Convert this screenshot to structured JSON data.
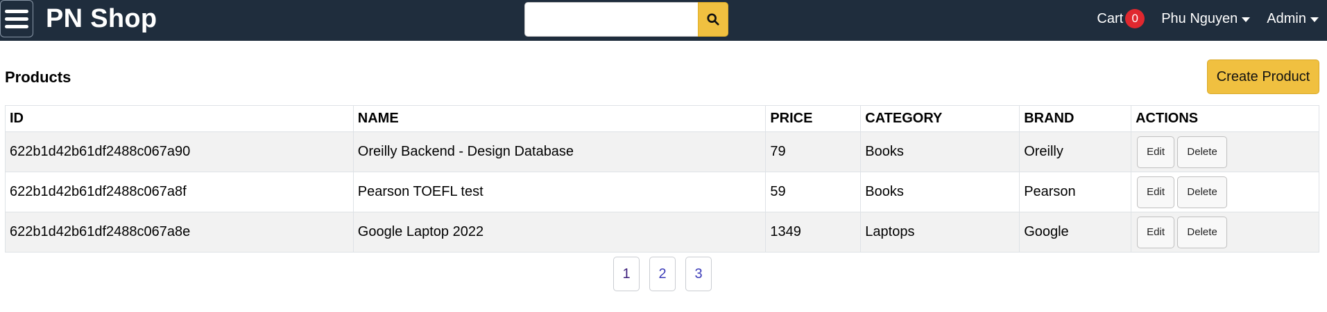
{
  "navbar": {
    "brand": "PN Shop",
    "search": {
      "value": "",
      "placeholder": ""
    },
    "cart_label": "Cart",
    "cart_count": "0",
    "user_name": "Phu Nguyen",
    "admin_label": "Admin"
  },
  "page": {
    "title": "Products",
    "create_label": "Create Product"
  },
  "table": {
    "headers": [
      "ID",
      "NAME",
      "PRICE",
      "CATEGORY",
      "BRAND",
      "ACTIONS"
    ],
    "rows": [
      {
        "id": "622b1d42b61df2488c067a90",
        "name": "Oreilly Backend - Design Database",
        "price": "79",
        "category": "Books",
        "brand": "Oreilly"
      },
      {
        "id": "622b1d42b61df2488c067a8f",
        "name": "Pearson TOEFL test",
        "price": "59",
        "category": "Books",
        "brand": "Pearson"
      },
      {
        "id": "622b1d42b61df2488c067a8e",
        "name": "Google Laptop 2022",
        "price": "1349",
        "category": "Laptops",
        "brand": "Google"
      }
    ],
    "edit_label": "Edit",
    "delete_label": "Delete"
  },
  "pagination": {
    "pages": [
      "1",
      "2",
      "3"
    ],
    "active": "1"
  },
  "colors": {
    "navbar": "#1f2d3d",
    "accent": "#f0c040",
    "badge": "#e0282f"
  }
}
